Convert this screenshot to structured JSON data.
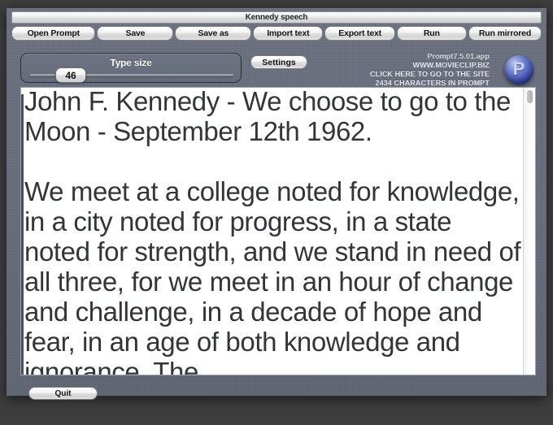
{
  "window": {
    "title": "Kennedy speech"
  },
  "toolbar": {
    "buttons": [
      {
        "label": "Open Prompt",
        "name": "open-prompt-button"
      },
      {
        "label": "Save",
        "name": "save-button"
      },
      {
        "label": "Save as",
        "name": "save-as-button"
      },
      {
        "label": "Import text",
        "name": "import-text-button"
      },
      {
        "label": "Export text",
        "name": "export-text-button"
      },
      {
        "label": "Run",
        "name": "run-button"
      },
      {
        "label": "Run mirrored",
        "name": "run-mirrored-button"
      }
    ]
  },
  "controls": {
    "type_size_label": "Type size",
    "type_size_value": "46",
    "settings_label": "Settings"
  },
  "branding": {
    "app_version": "Prompt7.5.01.app",
    "website": "WWW.MOVIECLIP.BIZ",
    "cta": "CLICK HERE TO GO TO THE SITE",
    "char_count": "2434 CHARACTERS IN PROMPT",
    "logo_letter": "P"
  },
  "editor": {
    "content": "John F. Kennedy - We choose to go to the Moon - September 12th 1962.\n\nWe meet at a college noted for knowledge, in a city noted for progress, in a state noted for strength, and we stand in need of all three, for we meet in an hour of change and challenge, in a decade of hope and fear, in an age of both knowledge and ignorance. The"
  },
  "footer": {
    "quit_label": "Quit"
  },
  "colors": {
    "frame": "#666b7b",
    "accent": "#4c5bbd",
    "editor_bg": "#ffffff",
    "text": "#333538"
  }
}
